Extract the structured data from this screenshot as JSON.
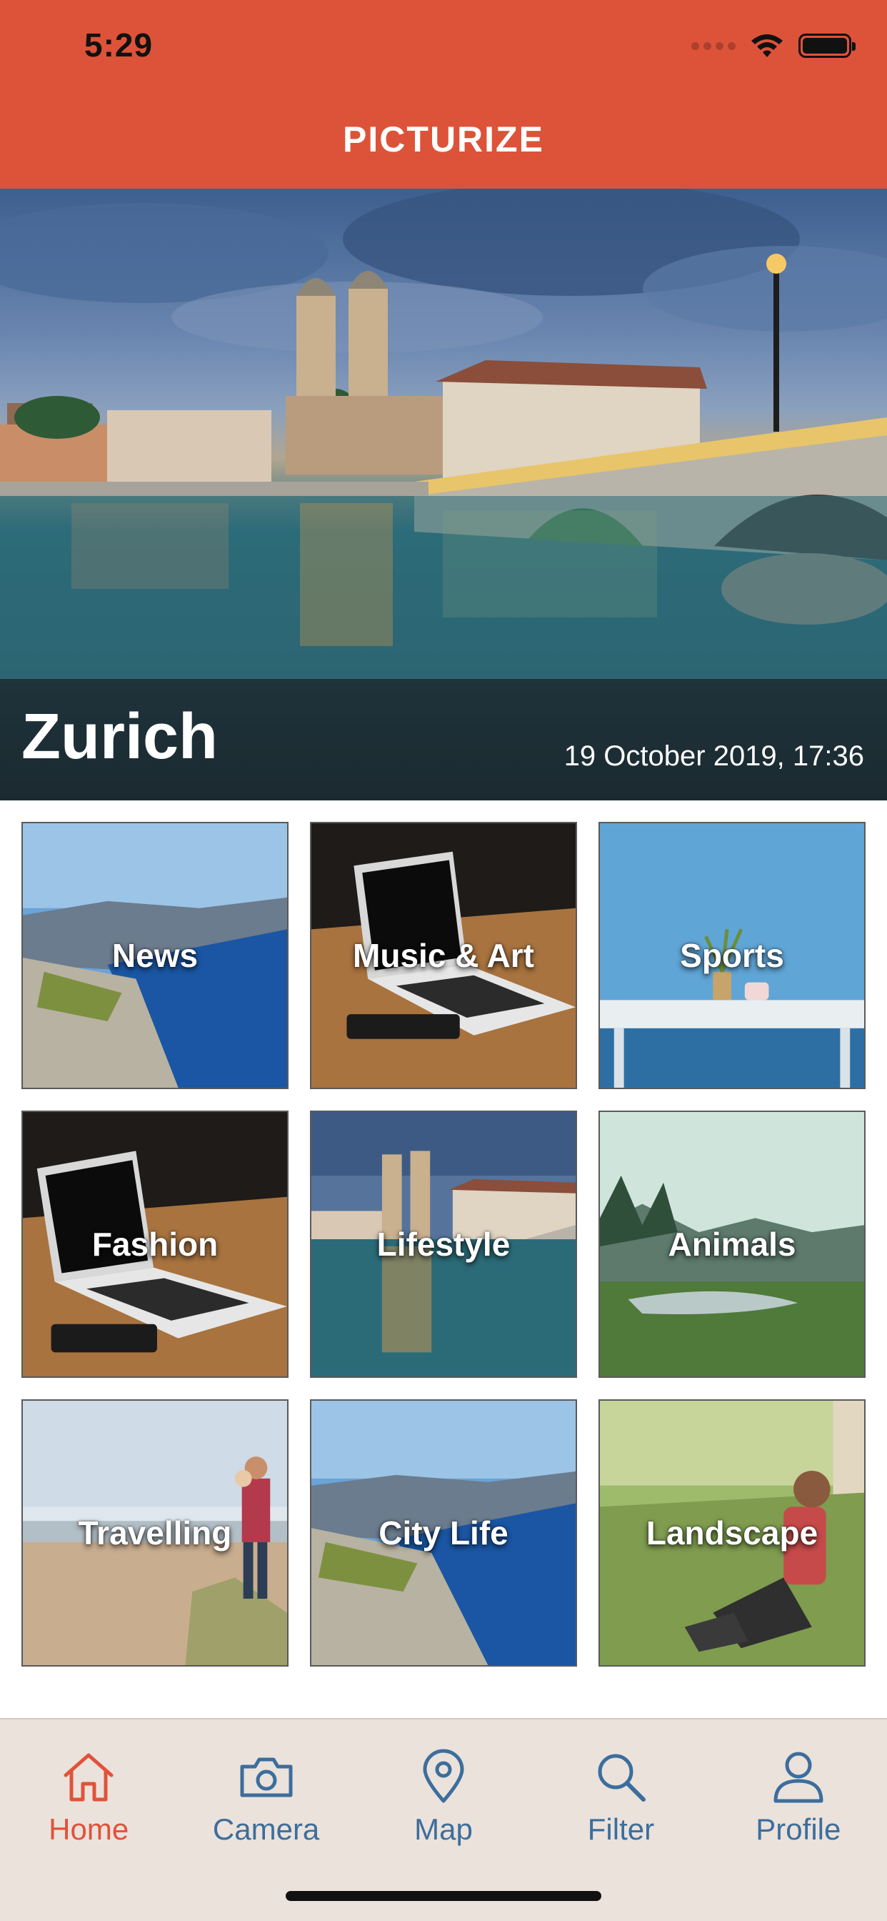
{
  "status_bar": {
    "time": "5:29",
    "icons": [
      "signal-dots",
      "wifi-icon",
      "battery-icon"
    ]
  },
  "header": {
    "title": "PICTURIZE",
    "background_color": "#dd5339"
  },
  "hero": {
    "city": "Zurich",
    "date": "19 October 2019, 17:36"
  },
  "categories": [
    {
      "label": "News"
    },
    {
      "label": "Music & Art"
    },
    {
      "label": "Sports"
    },
    {
      "label": "Fashion"
    },
    {
      "label": "Lifestyle"
    },
    {
      "label": "Animals"
    },
    {
      "label": "Travelling"
    },
    {
      "label": "City Life"
    },
    {
      "label": "Landscape"
    }
  ],
  "tabbar": {
    "active_color": "#e0533a",
    "inactive_color": "#3c6e9c",
    "items": [
      {
        "label": "Home",
        "icon": "home-icon",
        "active": true
      },
      {
        "label": "Camera",
        "icon": "camera-icon",
        "active": false
      },
      {
        "label": "Map",
        "icon": "map-pin-icon",
        "active": false
      },
      {
        "label": "Filter",
        "icon": "search-icon",
        "active": false
      },
      {
        "label": "Profile",
        "icon": "person-icon",
        "active": false
      }
    ]
  }
}
